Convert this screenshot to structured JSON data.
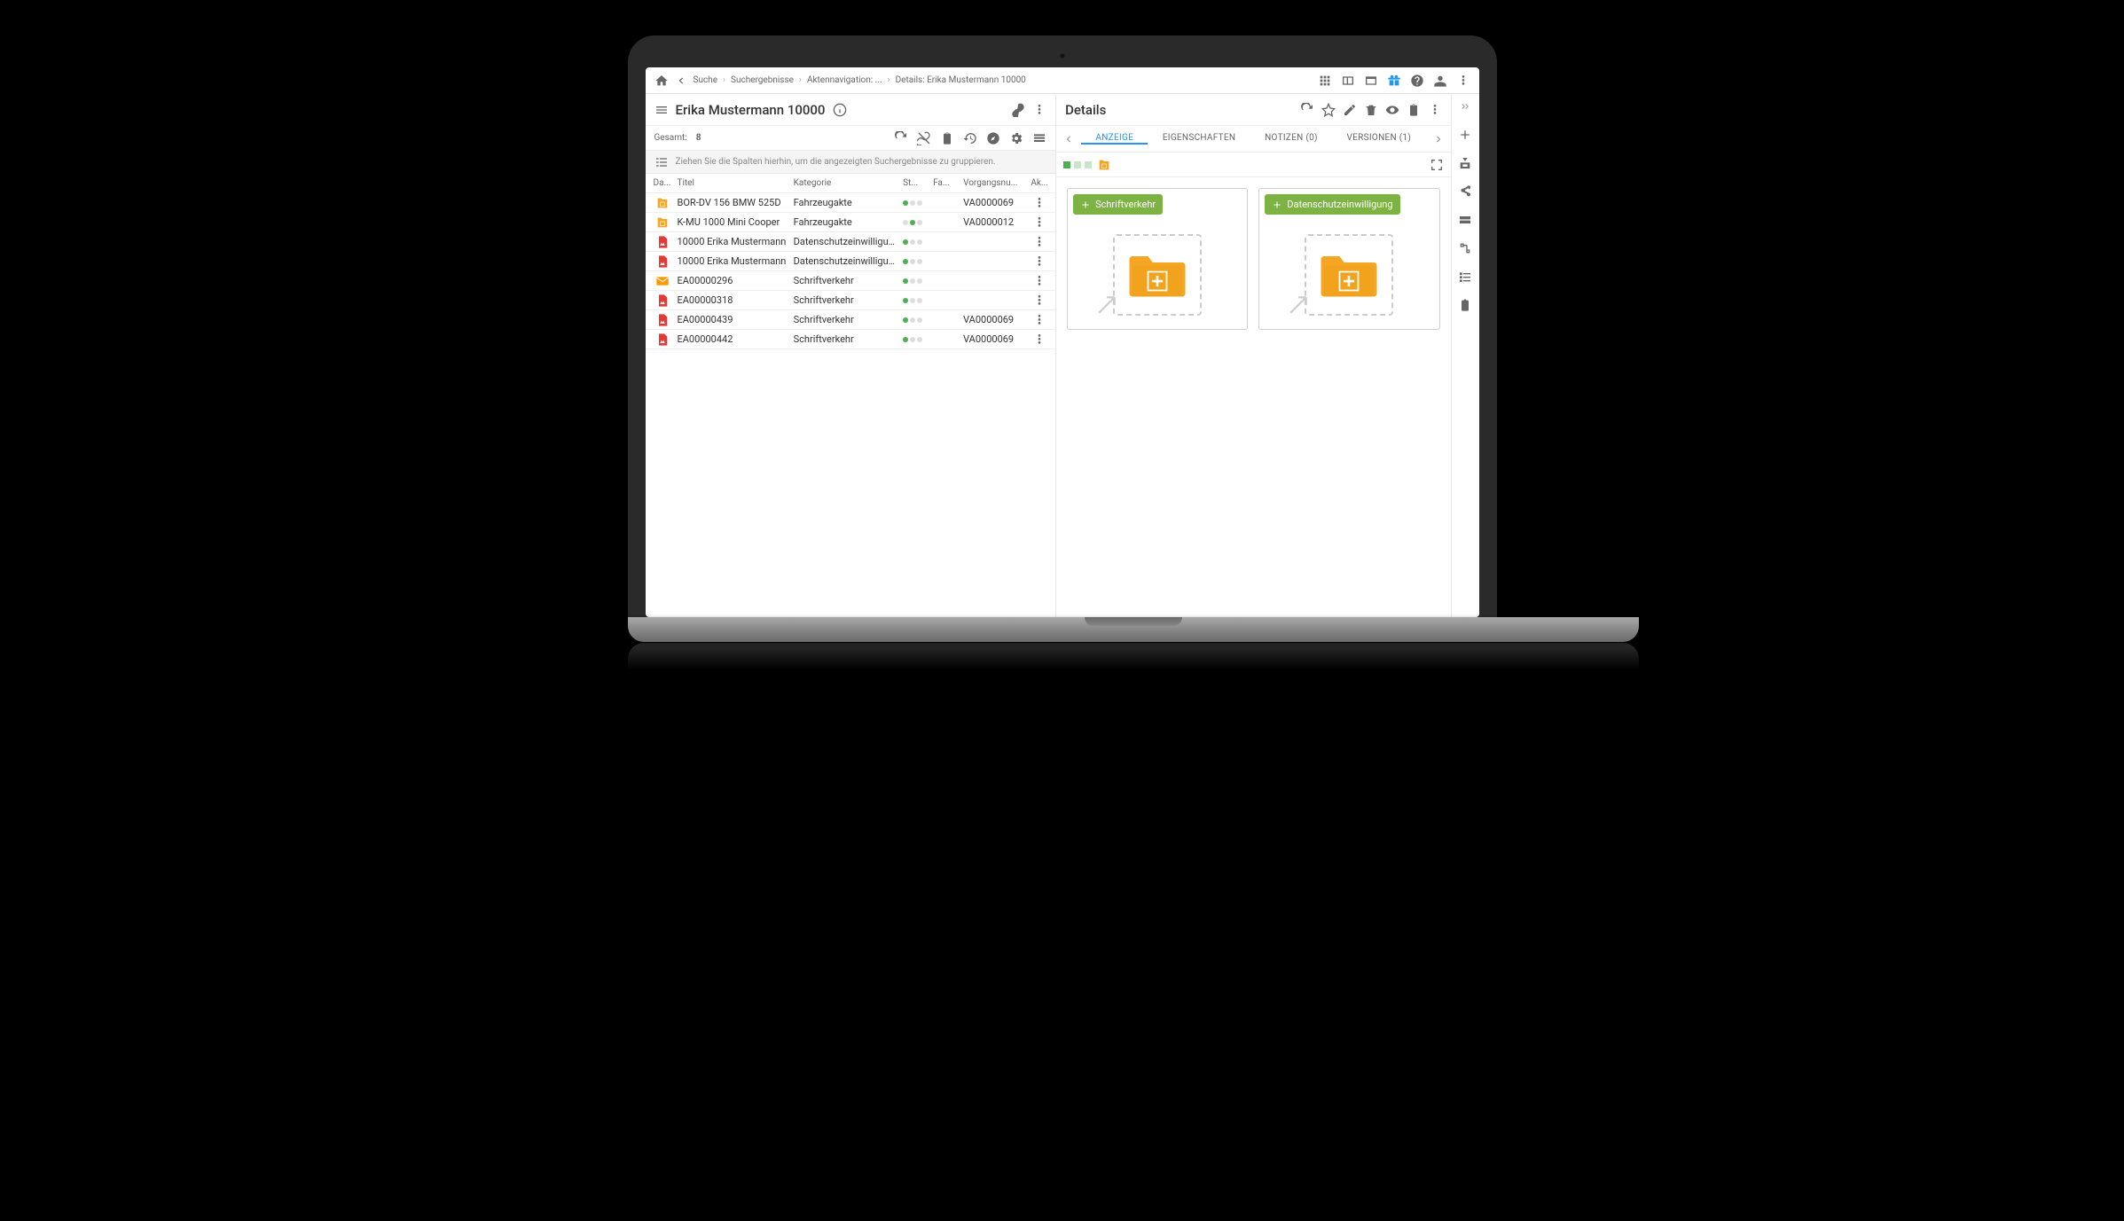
{
  "breadcrumbs": [
    "Suche",
    "Suchergebnisse",
    "Aktennavigation: ...",
    "Details: Erika Mustermann 10000"
  ],
  "left": {
    "title": "Erika Mustermann 10000",
    "total_label": "Gesamt:",
    "total_value": "8",
    "group_hint": "Ziehen Sie die Spalten hierhin, um die angezeigten Suchergebnisse zu gruppieren.",
    "columns": {
      "ico": "Da...",
      "title": "Titel",
      "cat": "Kategorie",
      "st": "St...",
      "fa": "Fa...",
      "vor": "Vorgangsnu...",
      "ak": "Ak..."
    },
    "rows": [
      {
        "icon": "folder",
        "title": "BOR-DV 156 BMW 525D",
        "cat": "Fahrzeugakte",
        "st": [
          "g",
          "gy",
          "gy"
        ],
        "vor": "VA0000069"
      },
      {
        "icon": "folder",
        "title": "K-MU 1000 Mini Cooper",
        "cat": "Fahrzeugakte",
        "st": [
          "gy",
          "g",
          "gy"
        ],
        "vor": "VA0000012"
      },
      {
        "icon": "pdf",
        "title": "10000 Erika Mustermann",
        "cat": "Datenschutzeinwilligung",
        "st": [
          "g",
          "gy",
          "gy"
        ],
        "vor": ""
      },
      {
        "icon": "pdf",
        "title": "10000 Erika Mustermann",
        "cat": "Datenschutzeinwilligung",
        "st": [
          "g",
          "gy",
          "gy"
        ],
        "vor": ""
      },
      {
        "icon": "mail",
        "title": "EA00000296",
        "cat": "Schriftverkehr",
        "st": [
          "g",
          "gy",
          "gy"
        ],
        "vor": ""
      },
      {
        "icon": "pdf",
        "title": "EA00000318",
        "cat": "Schriftverkehr",
        "st": [
          "g",
          "gy",
          "gy"
        ],
        "vor": ""
      },
      {
        "icon": "pdf",
        "title": "EA00000439",
        "cat": "Schriftverkehr",
        "st": [
          "g",
          "gy",
          "gy"
        ],
        "vor": "VA0000069"
      },
      {
        "icon": "pdf",
        "title": "EA00000442",
        "cat": "Schriftverkehr",
        "st": [
          "g",
          "gy",
          "gy"
        ],
        "vor": "VA0000069"
      }
    ]
  },
  "right": {
    "title": "Details",
    "tabs": [
      {
        "label": "ANZEIGE",
        "active": true
      },
      {
        "label": "EIGENSCHAFTEN",
        "active": false
      },
      {
        "label": "NOTIZEN (0)",
        "active": false
      },
      {
        "label": "VERSIONEN (1)",
        "active": false
      }
    ],
    "cards": [
      {
        "label": "Schriftverkehr"
      },
      {
        "label": "Datenschutzeinwilligung"
      }
    ]
  }
}
